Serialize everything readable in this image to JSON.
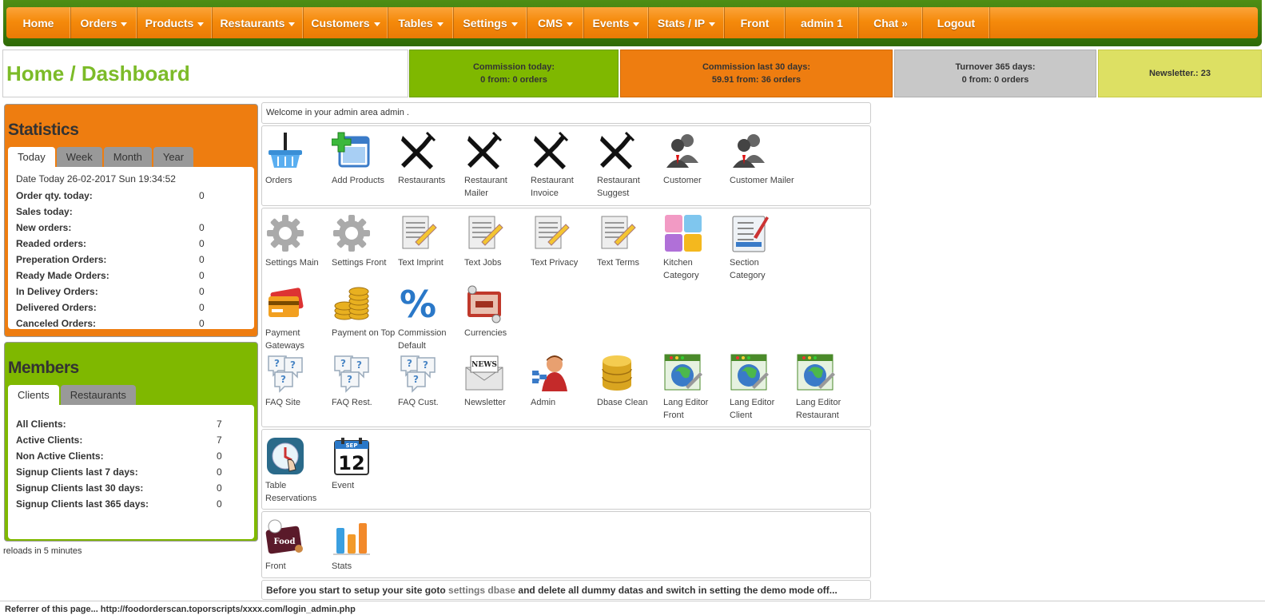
{
  "nav": {
    "items": [
      {
        "label": "Home",
        "dropdown": false
      },
      {
        "label": "Orders",
        "dropdown": true
      },
      {
        "label": "Products",
        "dropdown": true
      },
      {
        "label": "Restaurants",
        "dropdown": true
      },
      {
        "label": "Customers",
        "dropdown": true
      },
      {
        "label": "Tables",
        "dropdown": true
      },
      {
        "label": "Settings",
        "dropdown": true
      },
      {
        "label": "CMS",
        "dropdown": true
      },
      {
        "label": "Events",
        "dropdown": true
      },
      {
        "label": "Stats / IP",
        "dropdown": true
      },
      {
        "label": "Front",
        "dropdown": false
      },
      {
        "label": "admin 1",
        "dropdown": false
      },
      {
        "label": "Chat »",
        "dropdown": false
      },
      {
        "label": "Logout",
        "dropdown": false
      }
    ]
  },
  "header": {
    "title": "Home / Dashboard",
    "boxes": [
      {
        "line1": "Commission today:",
        "line2": "0 from: 0 orders",
        "color": "#7fb800"
      },
      {
        "line1": "Commission last 30 days:",
        "line2": "59.91 from: 36 orders",
        "color": "#ee7d10"
      },
      {
        "line1": "Turnover 365 days:",
        "line2": "0 from: 0 orders",
        "color": "#c8c8c8"
      },
      {
        "line1": "Newsletter.: 23",
        "line2": "",
        "color": "#dde063"
      }
    ]
  },
  "statistics": {
    "title": "Statistics",
    "tabs": [
      "Today",
      "Week",
      "Month",
      "Year"
    ],
    "date_line": "Date Today 26-02-2017 Sun 19:34:52",
    "rows": [
      {
        "label": "Order qty. today:",
        "value": "0"
      },
      {
        "label": "Sales today:",
        "value": ""
      },
      {
        "label": "New orders:",
        "value": "0"
      },
      {
        "label": "Readed orders:",
        "value": "0"
      },
      {
        "label": "Preperation Orders:",
        "value": "0"
      },
      {
        "label": "Ready Made Orders:",
        "value": "0"
      },
      {
        "label": "In Delivey Orders:",
        "value": "0"
      },
      {
        "label": "Delivered Orders:",
        "value": "0"
      },
      {
        "label": "Canceled Orders:",
        "value": "0"
      }
    ]
  },
  "members": {
    "title": "Members",
    "tabs": [
      "Clients",
      "Restaurants"
    ],
    "rows": [
      {
        "label": "All Clients:",
        "value": "7"
      },
      {
        "label": "Active Clients:",
        "value": "7"
      },
      {
        "label": "Non Active Clients:",
        "value": "0"
      },
      {
        "label": "Signup Clients last 7 days:",
        "value": "0"
      },
      {
        "label": "Signup Clients last 30 days:",
        "value": "0"
      },
      {
        "label": "Signup Clients last 365 days:",
        "value": "0"
      }
    ]
  },
  "reload_text": "reloads in 5 minutes",
  "welcome": "Welcome in your admin area admin .",
  "icons": {
    "orders": "Orders",
    "add_products": "Add Products",
    "restaurants": "Restaurants",
    "restaurant_mailer": "Restaurant Mailer",
    "restaurant_invoice": "Restaurant Invoice",
    "restaurant_suggest": "Restaurant Suggest",
    "customer": "Customer",
    "customer_mailer": "Customer Mailer",
    "settings_main": "Settings Main",
    "settings_front": "Settings Front",
    "text_imprint": "Text Imprint",
    "text_jobs": "Text Jobs",
    "text_privacy": "Text Privacy",
    "text_terms": "Text Terms",
    "kitchen_category": "Kitchen Category",
    "section_category": "Section Category",
    "payment_gateways": "Payment Gateways",
    "payment_on_top": "Payment on Top",
    "commission_default": "Commission Default",
    "currencies": "Currencies",
    "faq_site": "FAQ Site",
    "faq_rest": "FAQ Rest.",
    "faq_cust": "FAQ Cust.",
    "newsletter": "Newsletter",
    "admin": "Admin",
    "dbase_clean": "Dbase Clean",
    "lang_editor_front": "Lang Editor Front",
    "lang_editor_client": "Lang Editor Client",
    "lang_editor_restaurant": "Lang Editor Restaurant",
    "table_reservations": "Table Reservations",
    "event": "Event",
    "front": "Front",
    "stats": "Stats",
    "event_calendar_month": "SEP",
    "event_calendar_day": "12",
    "news_label": "NEWS",
    "food_label": "Food",
    "percent_symbol": "%"
  },
  "notice": {
    "before": "Before you start to setup your site goto ",
    "link": "settings dbase",
    "after": " and delete all dummy datas and switch in setting the demo mode off..."
  },
  "footer": "Referrer of this page... http://foodorderscan.toporscripts/xxxx.com/login_admin.php"
}
